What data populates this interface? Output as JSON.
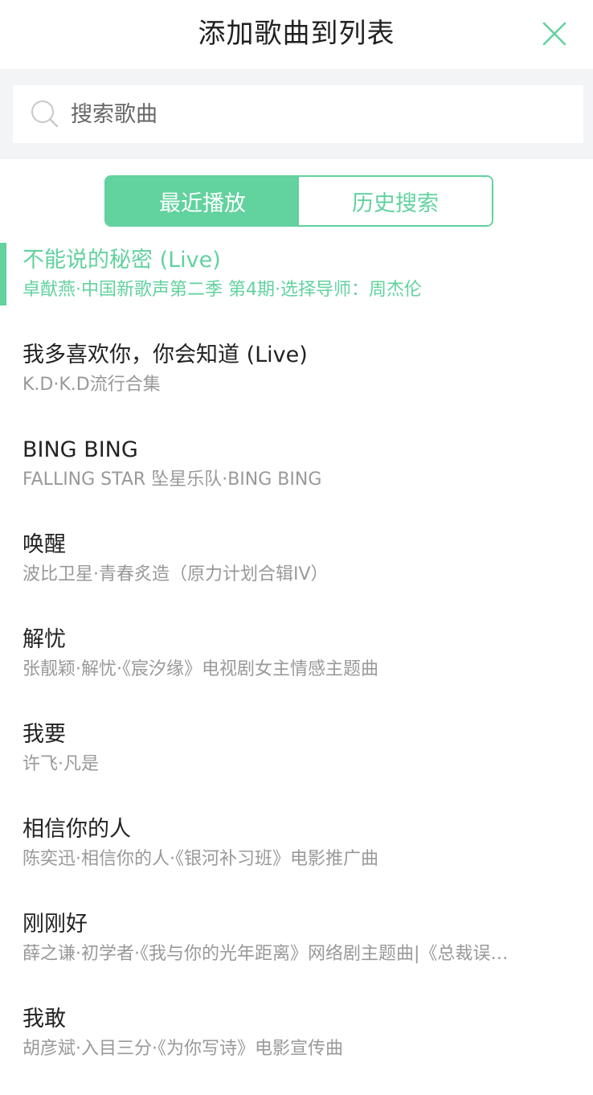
{
  "header": {
    "title": "添加歌曲到列表"
  },
  "search": {
    "placeholder": "搜索歌曲",
    "value": ""
  },
  "tabs": [
    {
      "label": "最近播放",
      "active": true
    },
    {
      "label": "历史搜索",
      "active": false
    }
  ],
  "songs": [
    {
      "title": "不能说的秘密 (Live)",
      "subtitle": "卓猷燕·中国新歌声第二季 第4期·选择导师：周杰伦",
      "playing": true
    },
    {
      "title": "我多喜欢你，你会知道 (Live)",
      "subtitle": "K.D·K.D流行合集",
      "playing": false
    },
    {
      "title": "BING BING",
      "subtitle": "FALLING STAR 坠星乐队·BING BING",
      "playing": false
    },
    {
      "title": "唤醒",
      "subtitle": "波比卫星·青春炙造（原力计划合辑IV）",
      "playing": false
    },
    {
      "title": "解忧",
      "subtitle": "张靓颖·解忧·《宸汐缘》电视剧女主情感主题曲",
      "playing": false
    },
    {
      "title": "我要",
      "subtitle": "许飞·凡是",
      "playing": false
    },
    {
      "title": "相信你的人",
      "subtitle": "陈奕迅·相信你的人·《银河补习班》电影推广曲",
      "playing": false
    },
    {
      "title": "刚刚好",
      "subtitle": "薛之谦·初学者·《我与你的光年距离》网络剧主题曲|《总裁误…",
      "playing": false
    },
    {
      "title": "我敢",
      "subtitle": "胡彦斌·入目三分·《为你写诗》电影宣传曲",
      "playing": false
    }
  ],
  "colors": {
    "accent": "#62d29e",
    "title_text": "#222222",
    "subtitle_text": "#999999",
    "search_bg": "#f3f4f6"
  },
  "icons": {
    "close": "close-icon",
    "search": "search-icon"
  }
}
